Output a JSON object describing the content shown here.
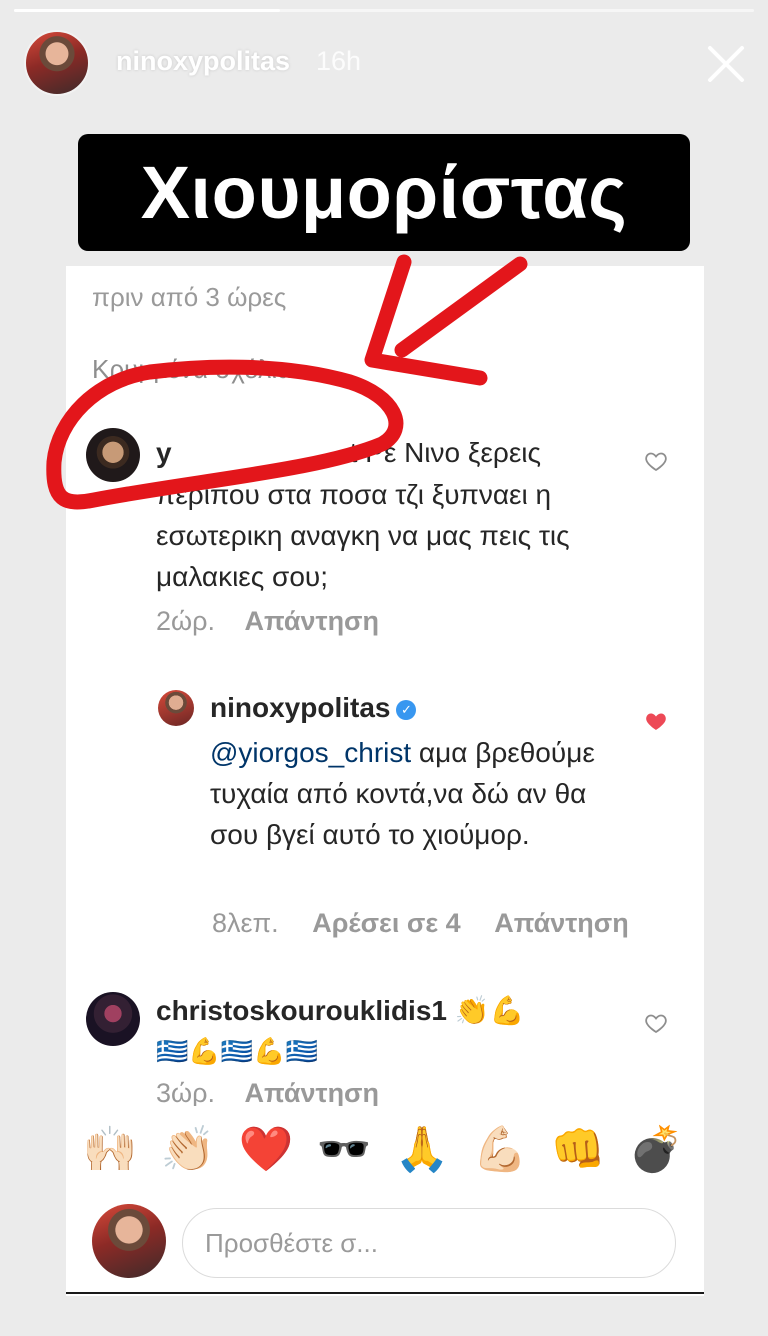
{
  "story": {
    "username": "ninoxypolitas",
    "time_ago": "16h",
    "progress": 0.36,
    "caption": "Χιουμορίστας"
  },
  "post": {
    "time_ago": "πριν από 3 ώρες",
    "hidden_comments_label": "Κρυμμένα σχόλια"
  },
  "comments": [
    {
      "username_visible": "y",
      "text_first_line_tail": "t Ρε Νινο ξερεις",
      "text_rest": "περιπου στα ποσα τζι ξυπναει η εσωτερικη αναγκη να μας πεις τις μαλακιες σου;",
      "time": "2ώρ.",
      "reply_label": "Απάντηση"
    },
    {
      "username": "ninoxypolitas",
      "mention": "@yiorgos_christ",
      "text": " αμα βρεθούμε τυχαία από κοντά,να δώ αν θα σου βγεί αυτό το χιούμορ.",
      "time": "8λεπ.",
      "likes_label": "Αρέσει σε 4",
      "reply_label": "Απάντηση"
    },
    {
      "username": "christoskourouklidis1",
      "text_line1": "👏💪",
      "text_line2": "🇬🇷💪🇬🇷💪🇬🇷",
      "time": "3ώρ.",
      "reply_label": "Απάντηση"
    }
  ],
  "reactions": [
    "🙌🏻",
    "👏🏻",
    "❤️",
    "🕶️",
    "🙏",
    "💪🏻",
    "👊",
    "💣"
  ],
  "composer": {
    "placeholder": "Προσθέστε σ..."
  },
  "colors": {
    "annotation_red": "#e3161b",
    "liked_heart": "#ed4956",
    "verified_blue": "#3897f0",
    "mention_blue": "#003569"
  }
}
